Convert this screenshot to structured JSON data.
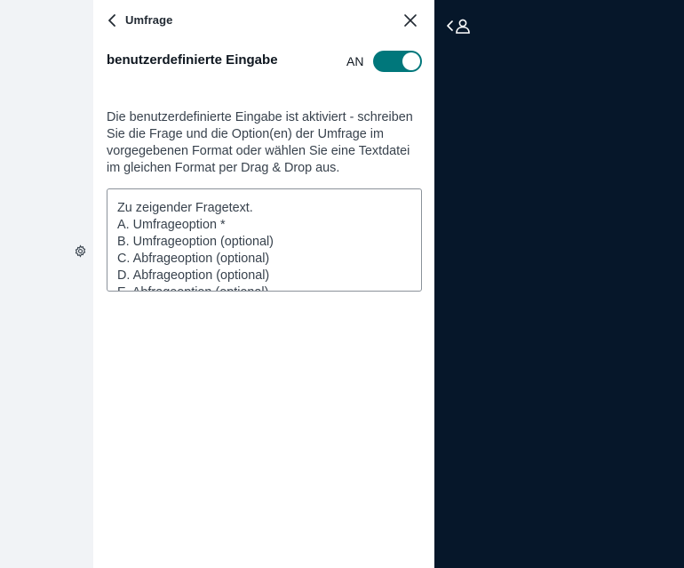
{
  "panel": {
    "title": "Umfrage"
  },
  "custom_input": {
    "label": "benutzerdefinierte Eingabe",
    "state_label": "AN",
    "enabled": true
  },
  "description": "Die benutzerdefinierte Eingabe ist aktiviert - schreiben Sie die Frage und die Option(en) der Umfrage im vorgegebenen Format oder wählen Sie eine Textdatei im gleichen Format per Drag & Drop aus.",
  "textarea": {
    "lines": [
      "Zu zeigender Fragetext.",
      "A. Umfrageoption *",
      "B. Umfrageoption (optional)",
      "C. Abfrageoption (optional)",
      "D. Abfrageoption (optional)",
      "E. Abfrageoption (optional)"
    ]
  },
  "colors": {
    "accent": "#00777b",
    "dark_pane": "#06172a",
    "rail": "#f1f3f6"
  },
  "icons": {
    "back": "chevron-left-icon",
    "close": "close-icon",
    "gear": "gear-icon",
    "user": "user-icon"
  }
}
